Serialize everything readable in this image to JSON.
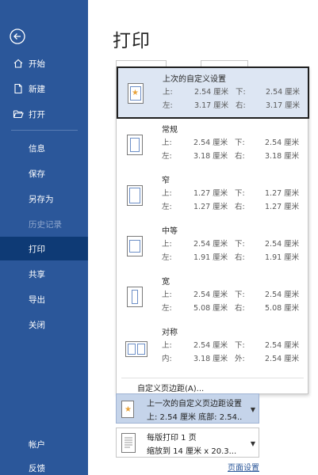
{
  "sidebar": {
    "items": [
      {
        "label": "开始"
      },
      {
        "label": "新建"
      },
      {
        "label": "打开"
      },
      {
        "label": "信息"
      },
      {
        "label": "保存"
      },
      {
        "label": "另存为"
      },
      {
        "label": "历史记录"
      },
      {
        "label": "打印"
      },
      {
        "label": "共享"
      },
      {
        "label": "导出"
      },
      {
        "label": "关闭"
      },
      {
        "label": "帐户"
      },
      {
        "label": "反馈"
      }
    ],
    "active": "打印",
    "bg_color": "#2b579a",
    "active_color": "#0e3a75"
  },
  "main": {
    "title": "打印"
  },
  "margins_menu": {
    "options": [
      {
        "name": "上次的自定义设置",
        "r1a": "上:",
        "r1b": "2.54 厘米",
        "r1c": "下:",
        "r1d": "2.54 厘米",
        "r2a": "左:",
        "r2b": "3.17 厘米",
        "r2c": "右:",
        "r2d": "3.17 厘米"
      },
      {
        "name": "常规",
        "r1a": "上:",
        "r1b": "2.54 厘米",
        "r1c": "下:",
        "r1d": "2.54 厘米",
        "r2a": "左:",
        "r2b": "3.18 厘米",
        "r2c": "右:",
        "r2d": "3.18 厘米"
      },
      {
        "name": "窄",
        "r1a": "上:",
        "r1b": "1.27 厘米",
        "r1c": "下:",
        "r1d": "1.27 厘米",
        "r2a": "左:",
        "r2b": "1.27 厘米",
        "r2c": "右:",
        "r2d": "1.27 厘米"
      },
      {
        "name": "中等",
        "r1a": "上:",
        "r1b": "2.54 厘米",
        "r1c": "下:",
        "r1d": "2.54 厘米",
        "r2a": "左:",
        "r2b": "1.91 厘米",
        "r2c": "右:",
        "r2d": "1.91 厘米"
      },
      {
        "name": "宽",
        "r1a": "上:",
        "r1b": "2.54 厘米",
        "r1c": "下:",
        "r1d": "2.54 厘米",
        "r2a": "左:",
        "r2b": "5.08 厘米",
        "r2c": "右:",
        "r2d": "5.08 厘米"
      },
      {
        "name": "对称",
        "r1a": "上:",
        "r1b": "2.54 厘米",
        "r1c": "下:",
        "r1d": "2.54 厘米",
        "r2a": "内:",
        "r2b": "3.18 厘米",
        "r2c": "外:",
        "r2d": "2.54 厘米"
      }
    ],
    "custom_label": "自定义页边距(A)..."
  },
  "margin_select": {
    "line1": "上一次的自定义页边距设置",
    "line2": "上: 2.54 厘米 底部: 2.54..."
  },
  "pages_select": {
    "line1": "每版打印 1 页",
    "line2": "缩放到 14 厘米 x 20.3..."
  },
  "page_setup_link": "页面设置"
}
